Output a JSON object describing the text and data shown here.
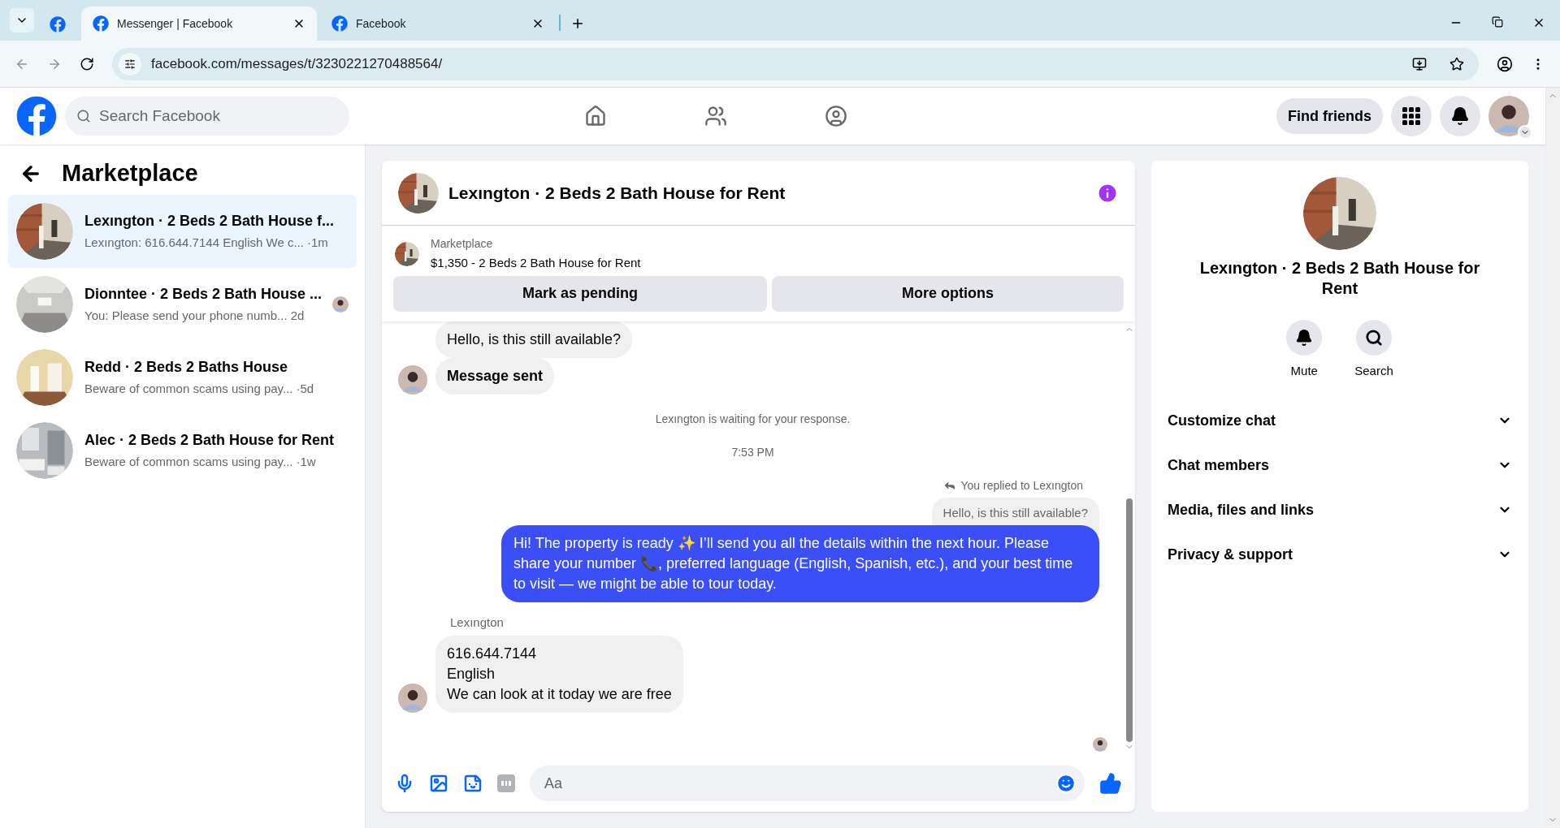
{
  "browser": {
    "tabs": [
      {
        "title": "Messenger | Facebook",
        "selected": true
      },
      {
        "title": "Facebook",
        "selected": false
      }
    ],
    "url": "facebook.com/messages/t/3230221270488564/"
  },
  "header": {
    "search": {
      "placeholder": "Search Facebook"
    },
    "nav": [
      {
        "selected": false
      },
      {
        "selected": false
      },
      {
        "selected": false
      }
    ],
    "find_friends": "Find friends"
  },
  "sidebar": {
    "title": "Marketplace",
    "conversations": [
      {
        "title": "Lexıngton · 2 Beds 2 Bath House f...",
        "preview": "Lexıngton: 616.644.7144 English We c...",
        "time": "·1m",
        "selected": true,
        "seen": false
      },
      {
        "title": "Dionntee · 2 Beds 2 Bath House ...",
        "preview": "You: Please send your phone numb...",
        "time": "2d",
        "selected": false,
        "seen": true
      },
      {
        "title": "Redd · 2 Beds 2 Baths House",
        "preview": "Beware of common scams using pay...",
        "time": "·5d",
        "selected": false,
        "seen": false
      },
      {
        "title": "Alec · 2 Beds 2 Bath House for Rent",
        "preview": "Beware of common scams using pay...",
        "time": "·1w",
        "selected": false,
        "seen": false
      }
    ]
  },
  "chat": {
    "title": "Lexıngton · 2 Beds 2 Bath House for Rent",
    "listing": {
      "label": "Marketplace",
      "title": "$1,350 - 2 Beds 2 Bath House for Rent"
    },
    "actions": [
      "Mark as pending",
      "More options"
    ],
    "messages": [
      {
        "kind": "incoming",
        "text": "Hello, is this still available?",
        "bold": false,
        "avatar": false
      },
      {
        "kind": "incoming",
        "text": "Message sent",
        "bold": true,
        "avatar": true
      },
      {
        "kind": "notice",
        "text": "Lexıngton is waiting for your response."
      },
      {
        "kind": "timestamp",
        "text": "7:53 PM"
      },
      {
        "kind": "outgoing",
        "reply_label": "You replied to Lexıngton",
        "quoted": "Hello, is this still available?",
        "text": "Hi! The property is ready ✨ I’ll send you all the details within the next hour. Please share your number 📞, preferred language (English, Spanish, etc.), and your best time to visit — we might be able to tour today."
      },
      {
        "kind": "incoming",
        "sender": "Lexıngton",
        "text": "616.644.7144\nEnglish\nWe can look at it today we are free",
        "bold": false,
        "avatar": true
      }
    ],
    "composer": {
      "placeholder": "Aa"
    }
  },
  "info": {
    "title": "Lexıngton · 2 Beds 2 Bath House for Rent",
    "actions": [
      {
        "kind": "bell",
        "label": "Mute"
      },
      {
        "kind": "search",
        "label": "Search"
      }
    ],
    "sections": [
      {
        "label": "Customize chat",
        "expanded": false
      },
      {
        "label": "Chat members",
        "expanded": false
      },
      {
        "label": "Media, files and links",
        "expanded": false
      },
      {
        "label": "Privacy & support",
        "expanded": false
      }
    ]
  }
}
